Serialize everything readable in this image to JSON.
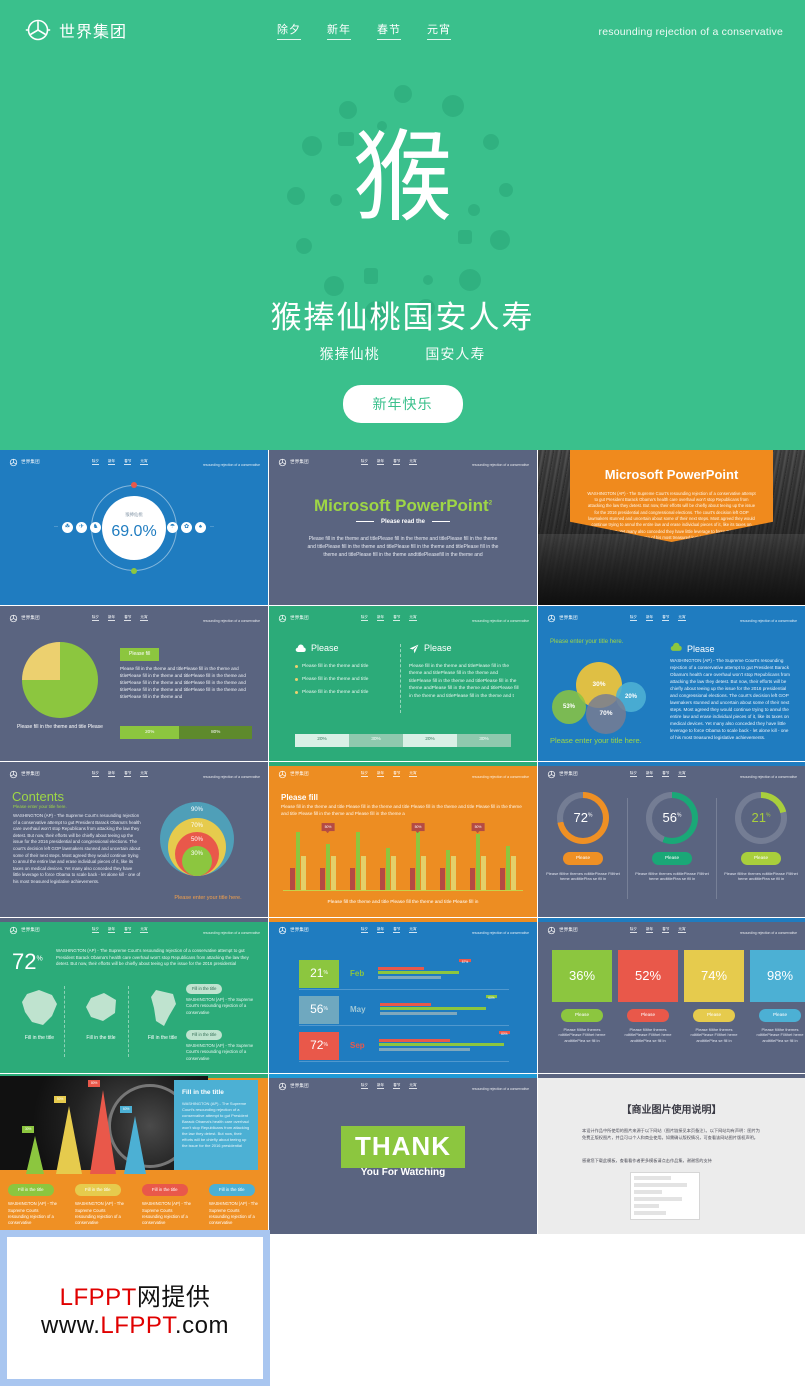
{
  "hero": {
    "brand_name": "世界集团",
    "nav": [
      "除夕",
      "新年",
      "春节",
      "元宵"
    ],
    "tagline": "resounding rejection of a conservative",
    "glyph": "猴",
    "title": "猴捧仙桃国安人寿",
    "sub_left": "猴捧仙桃",
    "sub_right": "国安人寿",
    "button": "新年快乐"
  },
  "thumb_common": {
    "brand_name": "世界集团",
    "nav": [
      "除夕",
      "新年",
      "春节",
      "元宵"
    ],
    "tagline": "resounding rejection of a conservative"
  },
  "slides": [
    {
      "id": "slide-donut-percent",
      "label": "猴捧仙桃",
      "value": "69.0%",
      "bg": "#1f7cc0"
    },
    {
      "id": "slide-title-powerpoint",
      "title": "Microsoft PowerPoint",
      "sup": "2",
      "read_label": "Please read the",
      "body": "Please fill in the theme and titlePlease fill in the theme and titlePlease fill in the theme and titlePlease fill in the theme and titlePlease fill in the theme and titlePlease fill in the theme and titlePlease fill in the theme andtitlePleasefill in the theme and",
      "bg": "#5a6480"
    },
    {
      "id": "slide-photo-banner",
      "title": "Microsoft PowerPoint",
      "body": "WASHINGTON (AP) - The Supreme Court's resounding rejection of a conservative attempt to gut President Barack Obama's health care overhaul won't stop Republicans from attacking the law they detest. But now, their efforts will be chiefly about teeing up the issue for the 2016 presidential and congressional elections. The court's decision left GOP lawmakers stunned and uncertain about some of their next steps. Most agreed they would continue trying to annul the entire law and erase individual pieces of it, like its taxes on medical devices. Yet many also conceded they have little leverage to force Obama to scale back - let alone kill - one of his most treasured legislative achievements.",
      "bg": "#f08a1d"
    },
    {
      "id": "slide-pie-chart",
      "chip": "Please fill",
      "pie_caption": "Please fill in the theme and title Please",
      "body": "Please fill in the theme and titlePlease fill in the theme and titlePlease fill in the theme and titlePlease fill in the theme and titlePlease fill in the theme and titlePlease fill in the theme and titlePlease fill in the theme and titlePlease fill in the theme and titlePlease fill in the theme and",
      "bar_values": [
        "20%",
        "80%"
      ],
      "bg": "#5a6480"
    },
    {
      "id": "slide-two-column-list",
      "left_heading": "Please",
      "right_heading": "Please",
      "bullets": [
        "Please fill in the theme and title",
        "Please fill in the theme and title",
        "Please fill in the theme and title"
      ],
      "right_body": "Please fill in the theme and titlePlease fill in the theme and titlePlease fill in the theme and titlePlease fill in the theme and titlePlease fill in the theme andPlease fill in the theme and titlePlease fill in the theme and titlePlease fill in the theme and t",
      "strip_values": [
        "20%",
        "30%",
        "20%",
        "30%"
      ],
      "bg": "#2cab79"
    },
    {
      "id": "slide-venn-bubbles",
      "top_title": "Please enter your title here.",
      "bottom_title": "Please enter your title here.",
      "bubbles": [
        "30%",
        "20%",
        "53%",
        "70%"
      ],
      "heading": "Please",
      "body": "WASHINGTON (AP) - The Supreme Court's resounding rejection of a conservative attempt to gut President Barack Obama's health care overhaul won't stop Republicans from attacking the law they detest. But now, their efforts will be chiefly about teeing up the issue for the 2016 presidential and congressional elections. The court's decision left GOP lawmakers stunned and uncertain about some of their next steps. Most agreed they would continue trying to annul the entire law and erase individual pieces of it, like its taxes on medical devices. Yet many also conceded they have little leverage to force Obama to scale back - let alone kill - one of his most treasured legislative achievements.",
      "bg": "#1f7cc0"
    },
    {
      "id": "slide-contents-rings",
      "title": "Contents",
      "subtitle": "Please enter your title here.",
      "body": "WASHINGTON (AP) - The Supreme Court's resounding rejection of a conservative attempt to gut President Barack Obama's health care overhaul won't stop Republicans from attacking the law they detest. But now, their efforts will be chiefly about teeing up the issue for the 2016 presidential and congressional elections. The court's decision left GOP lawmakers stunned and uncertain about some of their next steps. Most agreed they would continue trying to annul the entire law and erase individual pieces of it, like its taxes on medical devices. Yet many also conceded they have little leverage to force Obama to scale back - let alone kill - one of his most treasured legislative achievements.",
      "rings": [
        "90%",
        "70%",
        "50%",
        "30%"
      ],
      "caption": "Please enter your title here.",
      "bg": "#5a6480"
    },
    {
      "id": "slide-bar-chart",
      "title": "Please fill",
      "body": "Please fill in the theme and title Please fill in the theme and title Please fill in the theme and title Please fill in the theme and title Please fill in the theme and Please fill in the theme a",
      "flags": [
        "50%",
        "50%",
        "50%"
      ],
      "axis_caption": "Please fill the theme and title Please fill the theme and title Please fill in",
      "bg": "#ed8d22"
    },
    {
      "id": "slide-three-donuts",
      "donuts": [
        {
          "value": "72",
          "suffix": "%",
          "color": "#ef9024",
          "pill": "Please",
          "caption": "Please fillthe themes ndtitlePlease Fillthet heme andtitlePlea se fill in"
        },
        {
          "value": "56",
          "suffix": "%",
          "color": "#1aa877",
          "pill": "Please",
          "caption": "Please fillthe themes ndtitlePlease Fillthet heme andtitlePlea se fill in"
        },
        {
          "value": "21",
          "suffix": "%",
          "color": "#a9cf3c",
          "pill": "Please",
          "caption": "Please fillthe themes ndtitlePlease Fillthet heme andtitlePlea se fill in"
        }
      ],
      "bg": "#5a6480"
    },
    {
      "id": "slide-maps",
      "big_value": "72",
      "big_suffix": "%",
      "body": "WASHINGTON (AP) - The Supreme Court's resounding rejection of a conservative attempt to gut President Barack Obama's health care overhaul won't stop Republicans from attacking the law they detest. But now, their efforts will be chiefly about teeing up the issue for the 2016 presidential",
      "map_labels": [
        "Fill in the title",
        "Fill in the title",
        "Fill in the title"
      ],
      "side_items": [
        {
          "tag": "Fill in the title",
          "text": "WASHINGTON (AP) - The Supreme Court's resounding rejection of a conservative"
        },
        {
          "tag": "Fill in the title",
          "text": "WASHINGTON (AP) - The Supreme Court's resounding rejection of a conservative"
        }
      ],
      "bg": "#2cab79"
    },
    {
      "id": "slide-month-rows",
      "rows": [
        {
          "value": "21",
          "suffix": "%",
          "month": "Feb",
          "box_color": "#8cc63f",
          "month_color": "#8cc63f",
          "flag": "87%"
        },
        {
          "value": "56",
          "suffix": "%",
          "month": "May",
          "box_color": "#6fa8bf",
          "month_color": "#9fc7d6",
          "flag": "60%"
        },
        {
          "value": "72",
          "suffix": "%",
          "month": "Sep",
          "box_color": "#e9584a",
          "month_color": "#e9584a",
          "flag": "80%"
        }
      ],
      "bg": "#1f7cc0"
    },
    {
      "id": "slide-four-squares",
      "cells": [
        {
          "value": "36%",
          "color": "#8cc63f",
          "pill": "Please",
          "caption": "Please fillthe themes ndtitlePlease Fillthet heme andtitlePlea se fill in"
        },
        {
          "value": "52%",
          "color": "#e9584a",
          "pill": "Please",
          "caption": "Please fillthe themes ndtitlePlease Fillthet heme andtitlePlea se fill in"
        },
        {
          "value": "74%",
          "color": "#e6cb4d",
          "pill": "Please",
          "caption": "Please fillthe themes ndtitlePlease Fillthet heme andtitlePlea se fill in"
        },
        {
          "value": "98%",
          "color": "#4cb0d4",
          "pill": "Please",
          "caption": "Please fillthe themes ndtitlePlease Fillthet heme andtitlePlea se fill in"
        }
      ],
      "bg": "#5a6480"
    },
    {
      "id": "slide-cones-photo",
      "panel_title": "Fill in the title",
      "panel_body": "WASHINGTON (AP) - The Supreme Court's resounding rejection of a conservative attempt to gut President Barack Obama's health care overhaul won't stop Republicans from attacking the law they detest. But now, their efforts will be chiefly about teeing up the issue for the 2016 presidential",
      "cone_tips": [
        "30%",
        "50%",
        "80%",
        "60%"
      ],
      "footer": [
        {
          "pill": "Fill in the title",
          "color": "#8cc63f",
          "text": "WASHINGTON (AP) - The Supreme Courts resounding rejection of a conservative"
        },
        {
          "pill": "Fill in the title",
          "color": "#e6cb4d",
          "text": "WASHINGTON (AP) - The Supreme Courts resounding rejection of a conservative"
        },
        {
          "pill": "Fill in the title",
          "color": "#e9584a",
          "text": "WASHINGTON (AP) - The Supreme Courts resounding rejection of a conservative"
        },
        {
          "pill": "Fill in the title",
          "color": "#4cb0d4",
          "text": "WASHINGTON (AP) - The Supreme Courts resounding rejection of a conservative"
        }
      ],
      "bg": "#ef9024"
    },
    {
      "id": "slide-thank-you",
      "thank": "THANK",
      "sub": "You For Watching",
      "bg": "#5a6480"
    },
    {
      "id": "slide-image-notice",
      "title": "【商业图片使用说明】",
      "p1": "本设计作品中所使用的图片来源于以下网站（图片链接见本页备注）。以下网站均有声明：图片为免费正版权图片，并且可以个人和商业使用。如需确认版权情况，可查看该网站图片版权声明。",
      "p2": "感谢您下载此模板，查看看作者更多模板请点击作品集，谢谢您的支持",
      "bg": "#ececec"
    }
  ],
  "watermark": {
    "line1_red": "LFPPT",
    "line1_black": "网提供",
    "line2_pre": "www.",
    "line2_red": "LFPPT",
    "line2_post": ".com"
  }
}
